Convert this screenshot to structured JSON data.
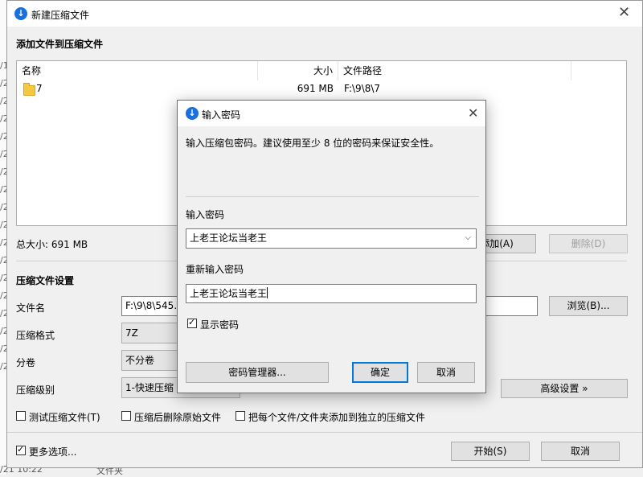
{
  "background_window": {
    "dates": [
      "/1",
      "/2",
      "/2",
      "/2",
      "/2",
      "/2",
      "/2",
      "/2",
      "/2",
      "/2",
      "/2",
      "/2",
      "/2",
      "/2",
      "/2",
      "/2",
      "/2",
      "/2"
    ],
    "bottom_left": "/21 10:22",
    "bottom_mid": "文件夹"
  },
  "main": {
    "title": "新建压缩文件",
    "add_section_title": "添加文件到压缩文件",
    "columns": {
      "name": "名称",
      "size": "大小",
      "path": "文件路径"
    },
    "rows": [
      {
        "name": "7",
        "size": "691 MB",
        "path": "F:\\9\\8\\7"
      }
    ],
    "total_size": "总大小: 691 MB",
    "add_button": "添加(A)",
    "delete_button": "删除(D)",
    "settings_title": "压缩文件设置",
    "file_name_label": "文件名",
    "file_name_value": "F:\\9\\8\\545.7",
    "browse_button": "浏览(B)...",
    "format_label": "压缩格式",
    "format_value": "7Z",
    "volume_label": "分卷",
    "volume_value": "不分卷",
    "level_label": "压缩级别",
    "level_value": "1-快速压缩",
    "advanced_button": "高级设置 »",
    "test_checkbox": "测试压缩文件(T)",
    "delete_after_checkbox": "压缩后删除原始文件",
    "each_file_checkbox": "把每个文件/文件夹添加到独立的压缩文件",
    "more_options_checkbox": "更多选项...",
    "start_button": "开始(S)",
    "cancel_button": "取消"
  },
  "dialog": {
    "title": "输入密码",
    "description": "输入压缩包密码。建议使用至少 8 位的密码来保证安全性。",
    "password_label": "输入密码",
    "password_value": "上老王论坛当老王",
    "confirm_label": "重新输入密码",
    "confirm_value": "上老王论坛当老王",
    "show_password": "显示密码",
    "manager_button": "密码管理器...",
    "ok_button": "确定",
    "cancel_button": "取消"
  },
  "colors": {
    "app_icon": "#1a6fdf",
    "primary_border": "#0078d7",
    "folder": "#f5c842"
  },
  "icons": {
    "app": "app-logo-icon",
    "folder": "folder-icon",
    "close": "close-icon",
    "dropdown": "chevron-down-icon"
  }
}
